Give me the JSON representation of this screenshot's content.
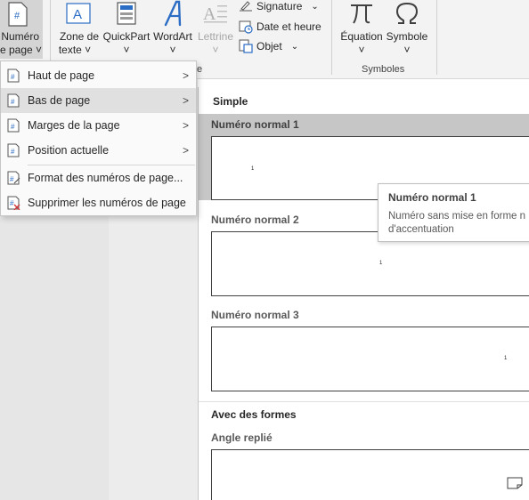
{
  "ribbon": {
    "page_number_button": {
      "line1": "Numéro",
      "line2": "e page ˅"
    },
    "text_box_button": {
      "line1": "Zone de",
      "line2": "texte ˅"
    },
    "quickpart_button": {
      "line1": "QuickPart",
      "line2": "˅"
    },
    "wordart_button": {
      "line1": "WordArt",
      "line2": "˅"
    },
    "lettrine_button": {
      "line1": "Lettrine",
      "line2": "˅"
    },
    "signature_label": "Signature",
    "datetime_label": "Date et heure",
    "object_label": "Objet",
    "equation_button": {
      "line1": "Équation",
      "line2": "˅"
    },
    "symbol_button": {
      "line1": "Symbole",
      "line2": "˅"
    },
    "symbols_group_label": "Symboles",
    "partial_group_label": "e"
  },
  "menu": {
    "items": [
      {
        "label": "Haut de page",
        "has_submenu": true
      },
      {
        "label": "Bas de page",
        "has_submenu": true,
        "active": true
      },
      {
        "label": "Marges de la page",
        "has_submenu": true
      },
      {
        "label": "Position actuelle",
        "has_submenu": true
      },
      {
        "label": "Format des numéros de page...",
        "has_submenu": false
      },
      {
        "label": "Supprimer les numéros de page",
        "has_submenu": false
      }
    ]
  },
  "gallery": {
    "section_simple": "Simple",
    "items": [
      {
        "label": "Numéro normal 1",
        "number": "1"
      },
      {
        "label": "Numéro normal 2",
        "number": "1"
      },
      {
        "label": "Numéro normal 3",
        "number": "1"
      }
    ],
    "section_shapes": "Avec des formes",
    "shape_item": {
      "label": "Angle replié"
    }
  },
  "tooltip": {
    "title": "Numéro normal 1",
    "description": "Numéro sans mise en forme n\nd'accentuation"
  },
  "colors": {
    "ribbon_bg": "#f3f3f3",
    "hover": "#c6c6c6",
    "accent_blue": "#2b6cc4"
  }
}
